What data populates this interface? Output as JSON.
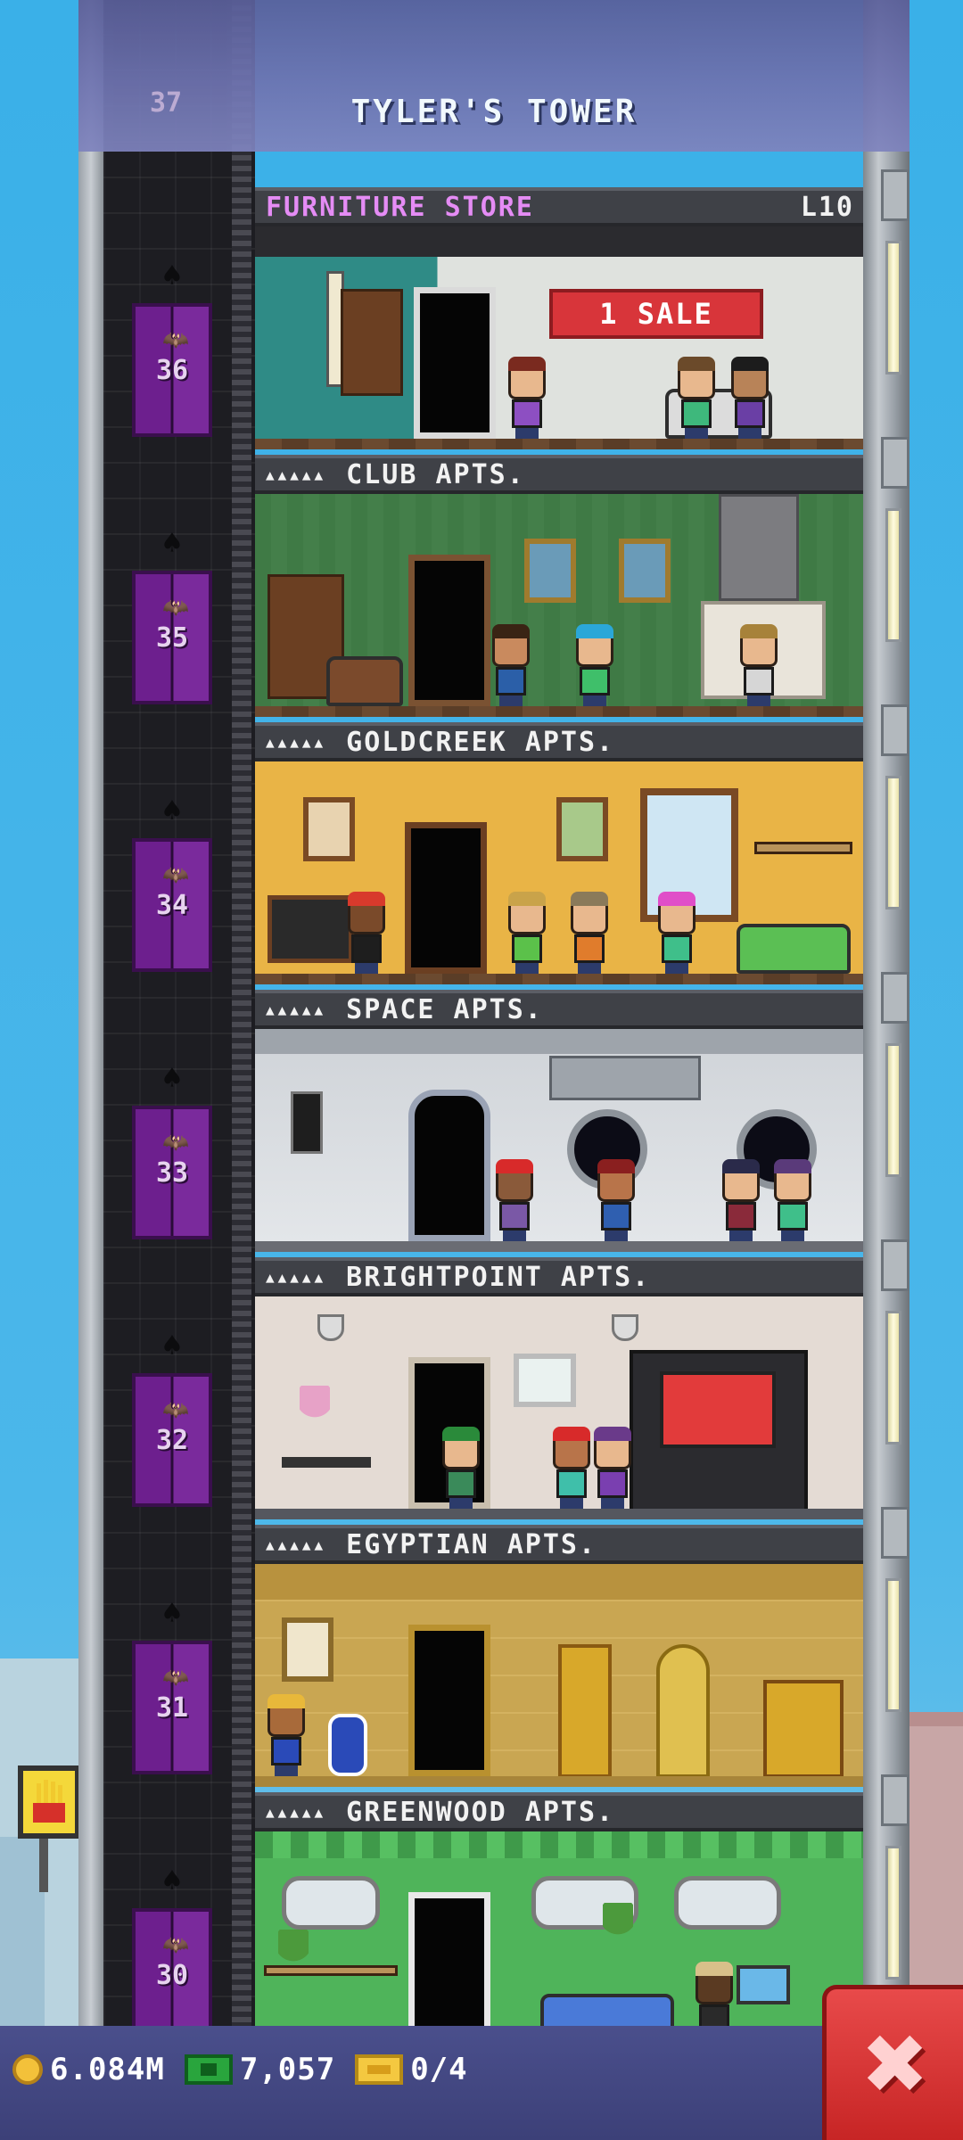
{
  "header": {
    "title": "TYLER'S TOWER",
    "ghost_floor": "37"
  },
  "colors": {
    "sky": "#3eb1e6",
    "elevator": "#6d1f8e",
    "store_label": "#e58cf5",
    "bar": "#4a4f8c",
    "close": "#d93232"
  },
  "floors": [
    {
      "number": "36",
      "label": "FURNITURE STORE",
      "level": "L10",
      "type": "store",
      "sign": "1 SALE"
    },
    {
      "number": "35",
      "label": "CLUB APTS.",
      "type": "apartment",
      "stars": "▲▲▲▲▲"
    },
    {
      "number": "34",
      "label": "GOLDCREEK APTS.",
      "type": "apartment",
      "stars": "▲▲▲▲▲"
    },
    {
      "number": "33",
      "label": "SPACE APTS.",
      "type": "apartment",
      "stars": "▲▲▲▲▲"
    },
    {
      "number": "32",
      "label": "BRIGHTPOINT APTS.",
      "type": "apartment",
      "stars": "▲▲▲▲▲"
    },
    {
      "number": "31",
      "label": "EGYPTIAN APTS.",
      "type": "apartment",
      "stars": "▲▲▲▲▲"
    },
    {
      "number": "30",
      "label": "GREENWOOD APTS.",
      "type": "apartment",
      "stars": "▲▲▲▲▲"
    }
  ],
  "bottom_bar": {
    "coins": "6.084M",
    "bux": "7,057",
    "tickets": "0/4",
    "coin_icon": "coin-icon",
    "bux_icon": "tower-bux-icon",
    "ticket_icon": "golden-ticket-icon",
    "close_icon": "close-icon",
    "close_glyph": "✖"
  }
}
